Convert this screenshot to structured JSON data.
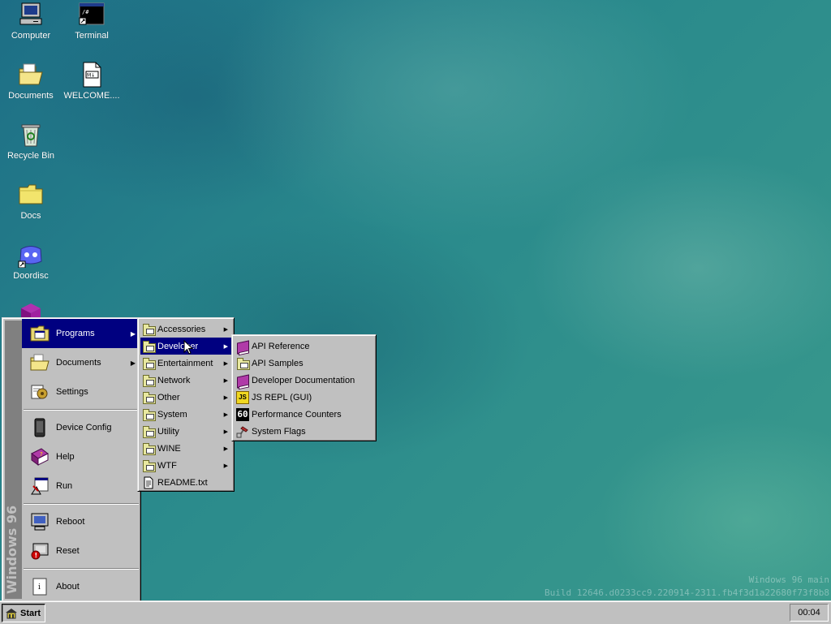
{
  "desktop": {
    "icons": [
      {
        "label": "Computer",
        "icon": "computer-icon"
      },
      {
        "label": "Terminal",
        "icon": "terminal-icon"
      },
      {
        "label": "Documents",
        "icon": "documents-folder-icon"
      },
      {
        "label": "WELCOME....",
        "icon": "markdown-file-icon"
      },
      {
        "label": "Recycle Bin",
        "icon": "recycle-bin-icon"
      },
      {
        "label": "Docs",
        "icon": "folder-icon"
      },
      {
        "label": "Doordisc",
        "icon": "doordisc-icon"
      }
    ],
    "watermark": {
      "line1": "Windows 96 main",
      "line2": "Build 12646.d0233cc9.220914-2311.fb4f3d1a22680f73f8b8"
    }
  },
  "start_menu": {
    "banner": "Windows 96",
    "items": [
      {
        "label": "Programs",
        "icon": "programs-folder-icon",
        "has_submenu": true
      },
      {
        "label": "Documents",
        "icon": "documents-folder-icon",
        "has_submenu": true
      },
      {
        "label": "Settings",
        "icon": "settings-icon",
        "has_submenu": false
      },
      {
        "label": "Device Config",
        "icon": "device-icon",
        "has_submenu": false
      },
      {
        "label": "Help",
        "icon": "help-book-icon",
        "has_submenu": false
      },
      {
        "label": "Run",
        "icon": "run-icon",
        "has_submenu": false
      },
      {
        "label": "Reboot",
        "icon": "reboot-icon",
        "has_submenu": false
      },
      {
        "label": "Reset",
        "icon": "reset-icon",
        "has_submenu": false
      },
      {
        "label": "About",
        "icon": "about-icon",
        "has_submenu": false
      }
    ]
  },
  "programs_menu": {
    "items": [
      {
        "label": "Accessories",
        "has_submenu": true
      },
      {
        "label": "Developer",
        "has_submenu": true
      },
      {
        "label": "Entertainment",
        "has_submenu": true
      },
      {
        "label": "Network",
        "has_submenu": true
      },
      {
        "label": "Other",
        "has_submenu": true
      },
      {
        "label": "System",
        "has_submenu": true
      },
      {
        "label": "Utility",
        "has_submenu": true
      },
      {
        "label": "WINE",
        "has_submenu": true
      },
      {
        "label": "WTF",
        "has_submenu": true
      },
      {
        "label": "README.txt",
        "has_submenu": false
      }
    ]
  },
  "developer_menu": {
    "items": [
      {
        "label": "API Reference",
        "icon": "book-icon"
      },
      {
        "label": "API Samples",
        "icon": "folder-icon"
      },
      {
        "label": "Developer Documentation",
        "icon": "book-icon"
      },
      {
        "label": "JS REPL (GUI)",
        "icon": "js-icon",
        "icon_text": "JS"
      },
      {
        "label": "Performance Counters",
        "icon": "counter-icon",
        "icon_text": "60"
      },
      {
        "label": "System Flags",
        "icon": "flags-icon"
      }
    ]
  },
  "taskbar": {
    "start_label": "Start",
    "clock": "00:04"
  },
  "colors": {
    "highlight": "#000080",
    "face": "#c0c0c0",
    "desktop": "#2a8a8c"
  }
}
